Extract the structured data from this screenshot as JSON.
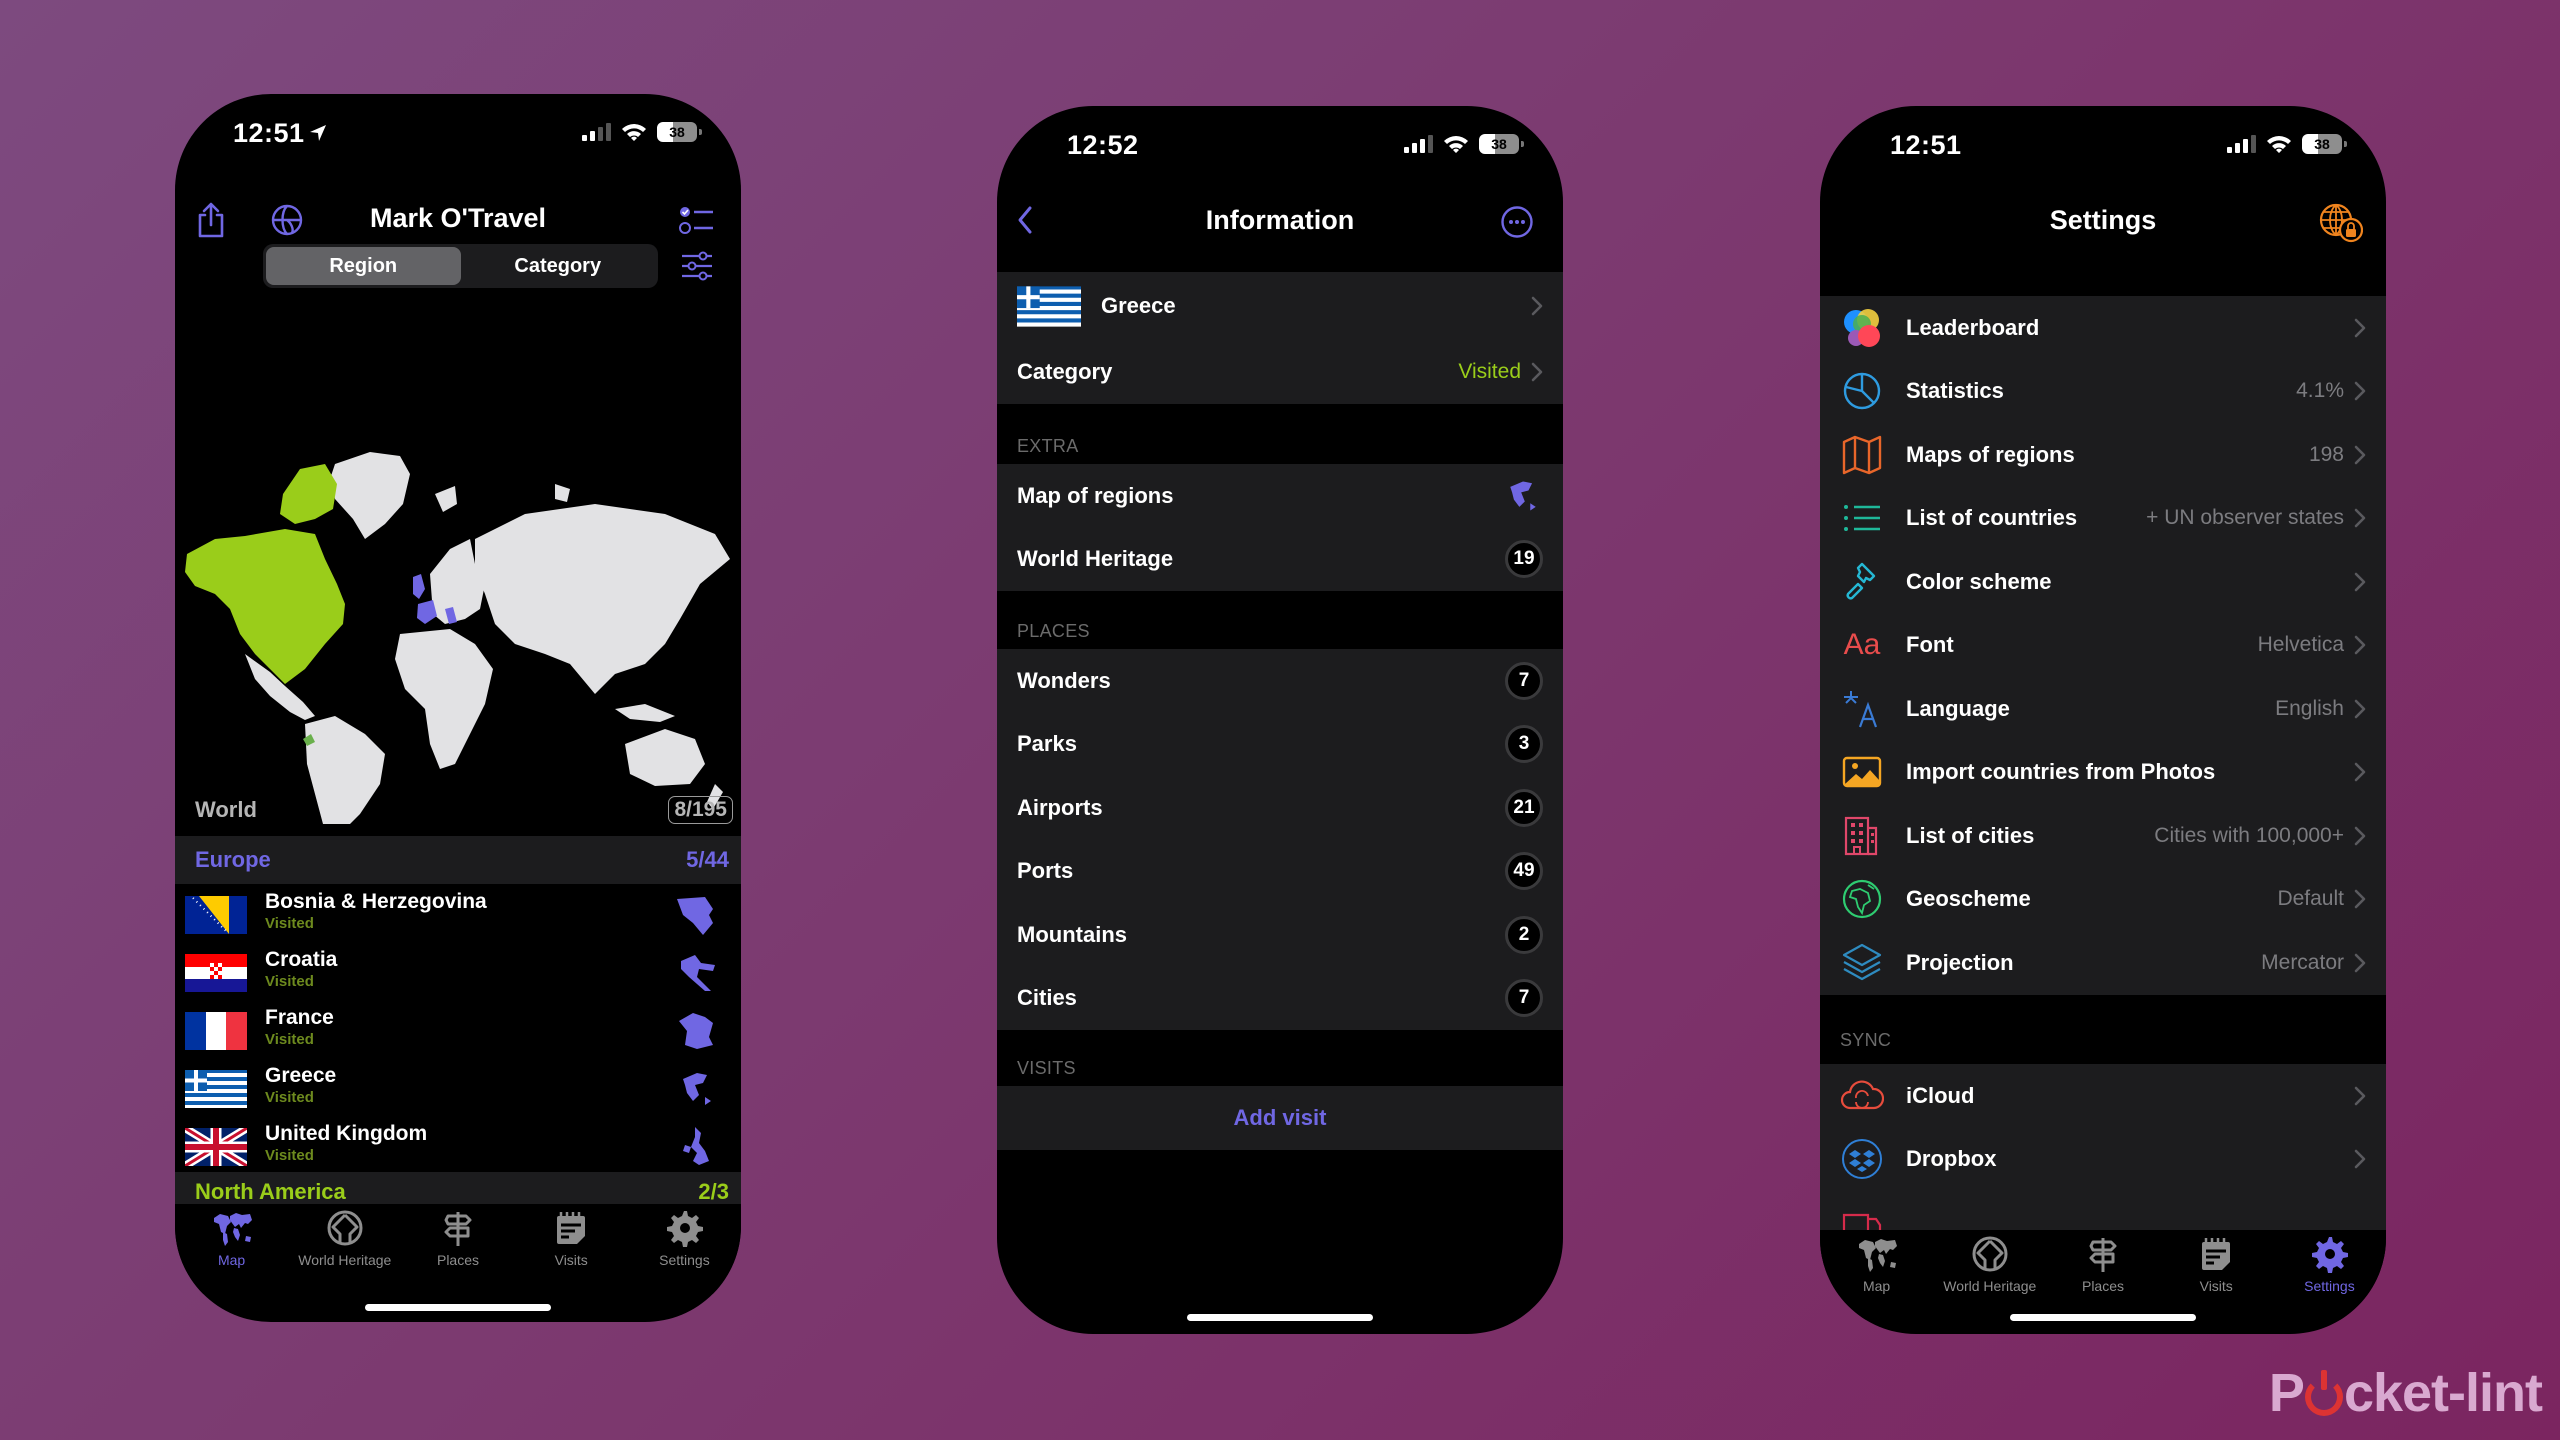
{
  "colors": {
    "accent": "#7067e3",
    "visited_green": "#9acd1a",
    "europe_purple": "#7067e3",
    "north_america_green": "#9acd1a",
    "background": "#7c3a70"
  },
  "phone_map": {
    "status": {
      "time": "12:51",
      "battery": "38",
      "location_icon": "location-arrow-icon"
    },
    "title": "Mark O'Travel",
    "toolbar_icons": [
      "share-icon",
      "globe-icon",
      "checklist-icon",
      "filter-sliders-icon"
    ],
    "segments": [
      {
        "label": "Region",
        "active": true
      },
      {
        "label": "Category",
        "active": false
      }
    ],
    "world": {
      "label": "World",
      "count": "8/195"
    },
    "regions": [
      {
        "name": "Europe",
        "count": "5/44",
        "countries": [
          {
            "name": "Bosnia & Herzegovina",
            "status": "Visited"
          },
          {
            "name": "Croatia",
            "status": "Visited"
          },
          {
            "name": "France",
            "status": "Visited"
          },
          {
            "name": "Greece",
            "status": "Visited"
          },
          {
            "name": "United Kingdom",
            "status": "Visited"
          }
        ]
      },
      {
        "name": "North America",
        "count": "2/3"
      }
    ],
    "tabs": [
      {
        "label": "Map",
        "icon": "world-map-icon",
        "active": true
      },
      {
        "label": "World Heritage",
        "icon": "world-heritage-icon",
        "active": false
      },
      {
        "label": "Places",
        "icon": "signpost-icon",
        "active": false
      },
      {
        "label": "Visits",
        "icon": "notepad-icon",
        "active": false
      },
      {
        "label": "Settings",
        "icon": "gear-icon",
        "active": false
      }
    ]
  },
  "phone_info": {
    "status": {
      "time": "12:52",
      "battery": "38"
    },
    "title": "Information",
    "country": {
      "name": "Greece"
    },
    "category": {
      "label": "Category",
      "value": "Visited"
    },
    "extra": {
      "header": "EXTRA",
      "rows": [
        {
          "label": "Map of regions"
        },
        {
          "label": "World Heritage",
          "count": "19"
        }
      ]
    },
    "places": {
      "header": "PLACES",
      "rows": [
        {
          "label": "Wonders",
          "count": "7"
        },
        {
          "label": "Parks",
          "count": "3"
        },
        {
          "label": "Airports",
          "count": "21"
        },
        {
          "label": "Ports",
          "count": "49"
        },
        {
          "label": "Mountains",
          "count": "2"
        },
        {
          "label": "Cities",
          "count": "7"
        }
      ]
    },
    "visits": {
      "header": "VISITS",
      "add_label": "Add visit"
    }
  },
  "phone_settings": {
    "status": {
      "time": "12:51",
      "battery": "38"
    },
    "title": "Settings",
    "main_rows": [
      {
        "label": "Leaderboard",
        "value": "",
        "icon": "leaderboard-icon"
      },
      {
        "label": "Statistics",
        "value": "4.1%",
        "icon": "pie-chart-icon"
      },
      {
        "label": "Maps of regions",
        "value": "198",
        "icon": "folded-map-icon"
      },
      {
        "label": "List of countries",
        "value": "+ UN observer states",
        "icon": "list-icon"
      },
      {
        "label": "Color scheme",
        "value": "",
        "icon": "paintbrush-icon"
      },
      {
        "label": "Font",
        "value": "Helvetica",
        "icon": "font-icon"
      },
      {
        "label": "Language",
        "value": "English",
        "icon": "language-icon"
      },
      {
        "label": "Import countries from Photos",
        "value": "",
        "icon": "photo-icon"
      },
      {
        "label": "List of cities",
        "value": "Cities with 100,000+",
        "icon": "building-icon"
      },
      {
        "label": "Geoscheme",
        "value": "Default",
        "icon": "globe-africa-icon"
      },
      {
        "label": "Projection",
        "value": "Mercator",
        "icon": "layers-icon"
      }
    ],
    "sync": {
      "header": "SYNC",
      "rows": [
        {
          "label": "iCloud",
          "icon": "icloud-sync-icon"
        },
        {
          "label": "Dropbox",
          "icon": "dropbox-icon"
        }
      ]
    },
    "tabs": [
      {
        "label": "Map",
        "active": false
      },
      {
        "label": "World Heritage",
        "active": false
      },
      {
        "label": "Places",
        "active": false
      },
      {
        "label": "Visits",
        "active": false
      },
      {
        "label": "Settings",
        "active": true
      }
    ]
  },
  "watermark": {
    "before": "P",
    "after": "cket-lint"
  }
}
